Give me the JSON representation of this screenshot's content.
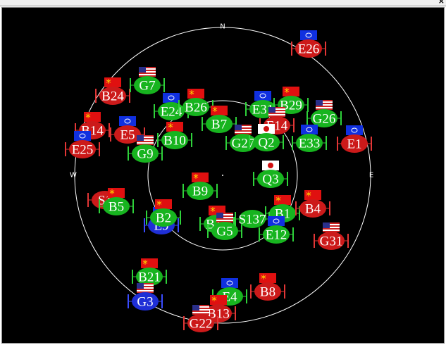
{
  "window": {
    "close_glyph": "×"
  },
  "compass": {
    "north": "N",
    "east": "E",
    "west": "W"
  },
  "colors": {
    "background": "#000000",
    "gps": "#1f2fd6",
    "beidou": "#cc1a1a",
    "green": "#17b41f",
    "ring": "#ffffff"
  },
  "satellites": [
    {
      "id": "E26",
      "body": "red",
      "flag": "eu"
    },
    {
      "id": "B24",
      "body": "red",
      "flag": "cn"
    },
    {
      "id": "G7",
      "body": "green",
      "flag": "us"
    },
    {
      "id": "E24",
      "body": "green",
      "flag": "eu"
    },
    {
      "id": "B26",
      "body": "green",
      "flag": "cn"
    },
    {
      "id": "E31",
      "body": "green",
      "flag": "eu"
    },
    {
      "id": "B29",
      "body": "green",
      "flag": "cn"
    },
    {
      "id": "G26",
      "body": "green",
      "flag": "us"
    },
    {
      "id": "B7",
      "body": "green",
      "flag": "cn"
    },
    {
      "id": "E14",
      "body": "red",
      "flag": "us"
    },
    {
      "id": "B14",
      "body": "red",
      "flag": "cn"
    },
    {
      "id": "E5",
      "body": "red",
      "flag": "eu"
    },
    {
      "id": "B10",
      "body": "green",
      "flag": "cn"
    },
    {
      "id": "G27",
      "body": "green",
      "flag": "us"
    },
    {
      "id": "Q2",
      "body": "green",
      "flag": "jp"
    },
    {
      "id": "E33",
      "body": "green",
      "flag": "eu"
    },
    {
      "id": "E1",
      "body": "red",
      "flag": "eu"
    },
    {
      "id": "E25",
      "body": "red",
      "flag": "eu"
    },
    {
      "id": "G9",
      "body": "green",
      "flag": "us"
    },
    {
      "id": "Q3",
      "body": "green",
      "flag": "jp"
    },
    {
      "id": "B9",
      "body": "green",
      "flag": "cn"
    },
    {
      "id": "S1",
      "body": "red",
      "flag": "none"
    },
    {
      "id": "B5",
      "body": "green",
      "flag": "cn"
    },
    {
      "id": "B1",
      "body": "green",
      "flag": "cn"
    },
    {
      "id": "B4",
      "body": "red",
      "flag": "cn"
    },
    {
      "id": "E9",
      "body": "blue",
      "flag": "eu"
    },
    {
      "id": "B2",
      "body": "green",
      "flag": "cn"
    },
    {
      "id": "B16",
      "body": "green",
      "flag": "cn"
    },
    {
      "id": "G5",
      "body": "green",
      "flag": "us"
    },
    {
      "id": "S137",
      "body": "green",
      "flag": "none"
    },
    {
      "id": "E12",
      "body": "green",
      "flag": "eu"
    },
    {
      "id": "G31",
      "body": "red",
      "flag": "us"
    },
    {
      "id": "B21",
      "body": "green",
      "flag": "cn"
    },
    {
      "id": "G3",
      "body": "blue",
      "flag": "us"
    },
    {
      "id": "E4",
      "body": "green",
      "flag": "eu"
    },
    {
      "id": "B8",
      "body": "red",
      "flag": "cn"
    },
    {
      "id": "B13",
      "body": "red",
      "flag": "cn"
    },
    {
      "id": "G22",
      "body": "red",
      "flag": "us"
    }
  ]
}
